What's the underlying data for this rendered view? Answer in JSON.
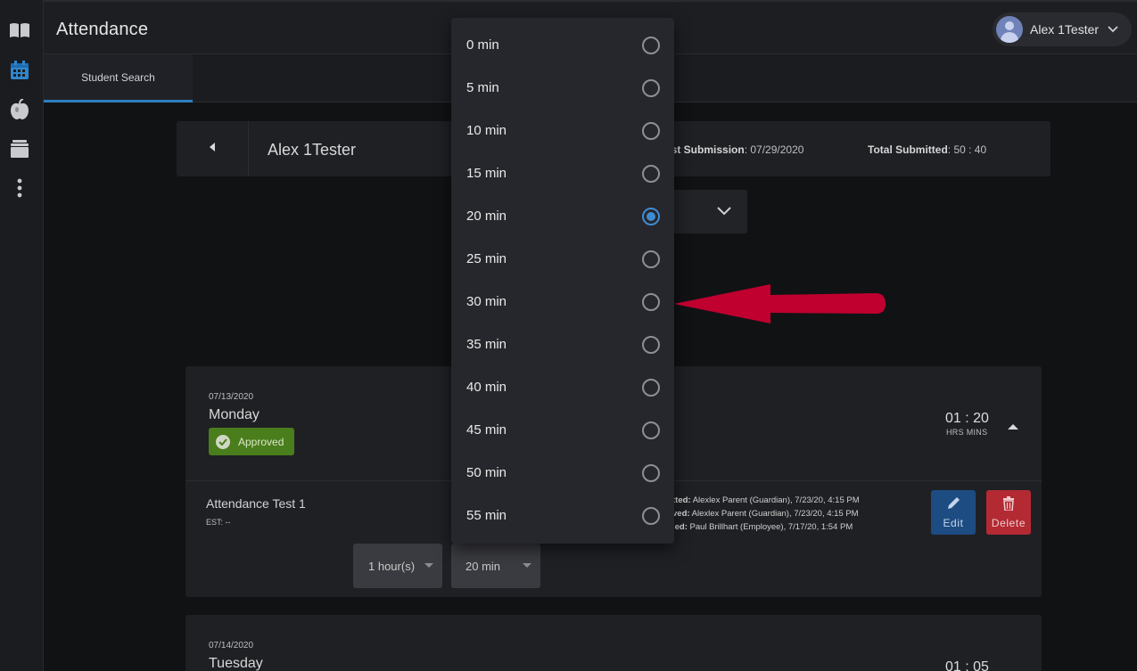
{
  "app": {
    "title": "Attendance"
  },
  "user": {
    "name": "Alex 1Tester"
  },
  "tabs": [
    {
      "label": "Student Search"
    }
  ],
  "student": {
    "name": "Alex 1Tester",
    "last_submission_label": "ast Submission",
    "last_submission_value": ": 07/29/2020",
    "total_submitted_label": "Total Submitted",
    "total_submitted_value": ": 50 : 40"
  },
  "days": [
    {
      "date": "07/13/2020",
      "name": "Monday",
      "status": "Approved",
      "total": "01 : 20",
      "total_units": "HRS MINS",
      "entry": {
        "title": "Attendance Test 1",
        "est": "EST: --",
        "audit": [
          {
            "label": "tted:",
            "value": " Alexlex Parent (Guardian), 7/23/20, 4:15 PM"
          },
          {
            "label": "ved:",
            "value": " Alexlex Parent (Guardian), 7/23/20, 4:15 PM"
          },
          {
            "label": "ied:",
            "value": " Paul Brillhart (Employee), 7/17/20, 1:54 PM"
          }
        ],
        "hours_value": "1 hour(s)",
        "minutes_value": "20 min",
        "edit_label": "Edit",
        "delete_label": "Delete"
      }
    },
    {
      "date": "07/14/2020",
      "name": "Tuesday",
      "total": "01 : 05"
    }
  ],
  "minute_dropdown": {
    "options": [
      "0 min",
      "5 min",
      "10 min",
      "15 min",
      "20 min",
      "25 min",
      "30 min",
      "35 min",
      "40 min",
      "45 min",
      "50 min",
      "55 min"
    ],
    "selected": "20 min"
  },
  "colors": {
    "accent": "#3f8bd1",
    "approved": "#4a7d1c",
    "delete": "#b32a33",
    "edit": "#1d4c82",
    "annotation_arrow": "#c0002f"
  },
  "icons": {
    "sidebar": [
      "book-icon",
      "calendar-icon",
      "apple-icon",
      "archive-icon",
      "more-vertical-icon"
    ]
  }
}
